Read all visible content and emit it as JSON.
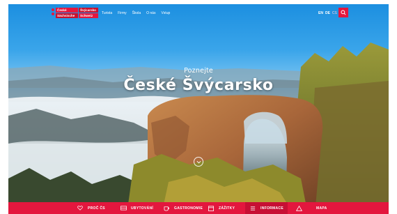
{
  "header": {
    "logo": {
      "line1_left": "České",
      "line1_right": "Švýcarsko",
      "line2_left": "Sächsische",
      "line2_right": "Schweiz",
      "brand_color": "#e3173e"
    },
    "nav": [
      {
        "label": "Turista"
      },
      {
        "label": "Firmy"
      },
      {
        "label": "Škola"
      },
      {
        "label": "O nás"
      },
      {
        "label": "Vstup"
      }
    ],
    "languages": [
      {
        "label": "EN",
        "active": true
      },
      {
        "label": "DE",
        "active": true
      },
      {
        "label": "CS",
        "active": false
      }
    ],
    "search_icon": "search-icon"
  },
  "hero": {
    "subtitle": "Poznejte",
    "title": "České Švýcarsko",
    "scroll_icon": "chevron-down-icon"
  },
  "bottom_nav": [
    {
      "icon": "heart-icon",
      "label": "PROČ ČS"
    },
    {
      "icon": "bed-icon",
      "label": "UBYTOVÁNÍ"
    },
    {
      "icon": "cup-icon",
      "label": "GASTRONOMIE"
    },
    {
      "icon": "calendar-icon",
      "label": "ZÁŽITKY"
    },
    {
      "icon": "info-icon",
      "label": "INFORMACE"
    },
    {
      "icon": "map-icon",
      "label": "MAPA"
    }
  ],
  "colors": {
    "accent": "#e3173e",
    "accent_dark": "#c70f34"
  }
}
